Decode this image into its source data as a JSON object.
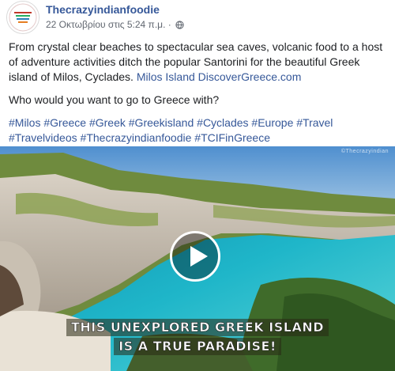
{
  "post": {
    "page_name": "Thecrazyindianfoodie",
    "timestamp": "22 Οκτωβρίου στις 5:24 π.μ.",
    "separator": " · ",
    "privacy_icon": "globe-icon",
    "body_text": "From crystal clear beaches to spectacular sea caves, volcanic food to a host of adventure activities ditch the popular Santorini for the beautiful Greek island of Milos, Cyclades.",
    "body_link": "Milos Island DiscoverGreece.com",
    "question": "Who would you want to go to Greece with?",
    "hashtags": [
      "#Milos",
      "#Greece",
      "#Greek",
      "#Greekisland",
      "#Cyclades",
      "#Europe",
      "#Travel",
      "#Travelvideos",
      "#Thecrazyindianfoodie",
      "#TCIFinGreece"
    ]
  },
  "video": {
    "watermark": "©Thecrazyindian",
    "caption_line1": "THIS UNEXPLORED GREEK ISLAND",
    "caption_line2": "IS A TRUE PARADISE!",
    "play_icon": "play-icon"
  },
  "colors": {
    "link": "#365899",
    "sea": "#1fb6c9",
    "sky": "#6fa7d6"
  }
}
